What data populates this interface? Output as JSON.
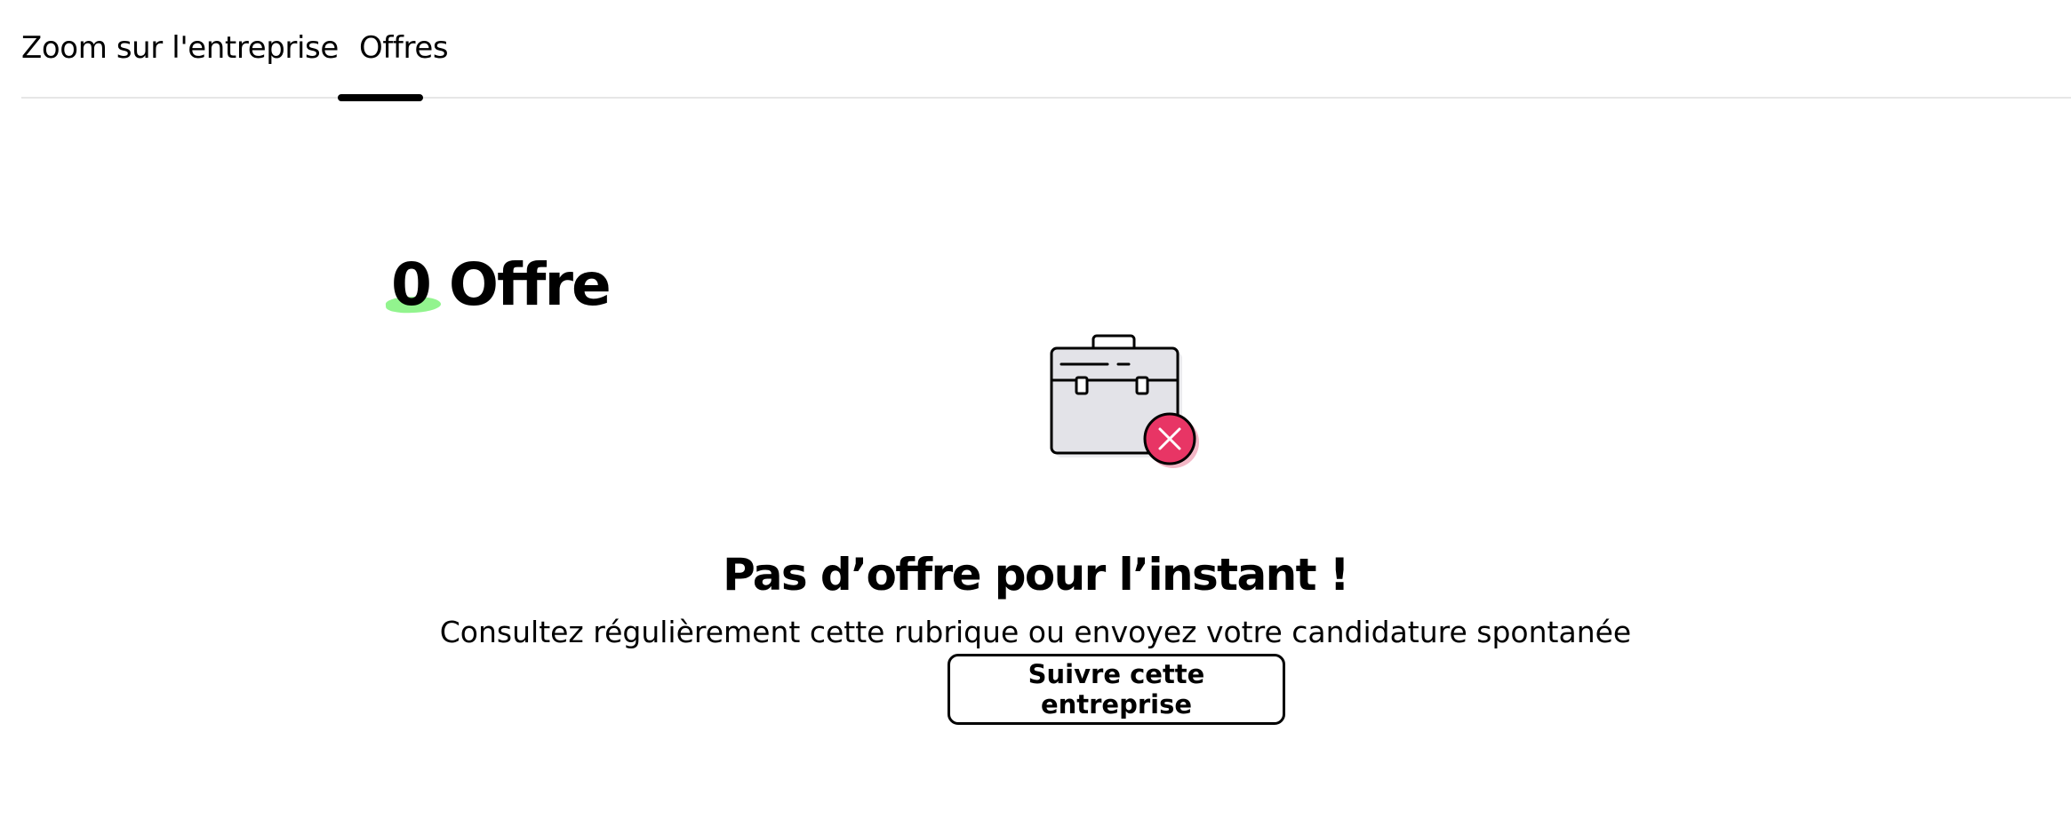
{
  "tabs": [
    {
      "label": "Zoom sur l'entreprise",
      "active": false
    },
    {
      "label": "Offres",
      "active": true
    }
  ],
  "offers": {
    "count": "0",
    "label": "Offre"
  },
  "empty_state": {
    "icon": "briefcase-cross-icon",
    "title": "Pas d’offre pour l’instant !",
    "message": "Consultez régulièrement cette rubrique ou envoyez votre candidature spontanée",
    "button_label": "Suivre cette entreprise"
  },
  "colors": {
    "highlight": "#7ff27a",
    "badge": "#e83565",
    "briefcase_fill": "#e3e3e8",
    "divider": "#e6e6e6"
  }
}
